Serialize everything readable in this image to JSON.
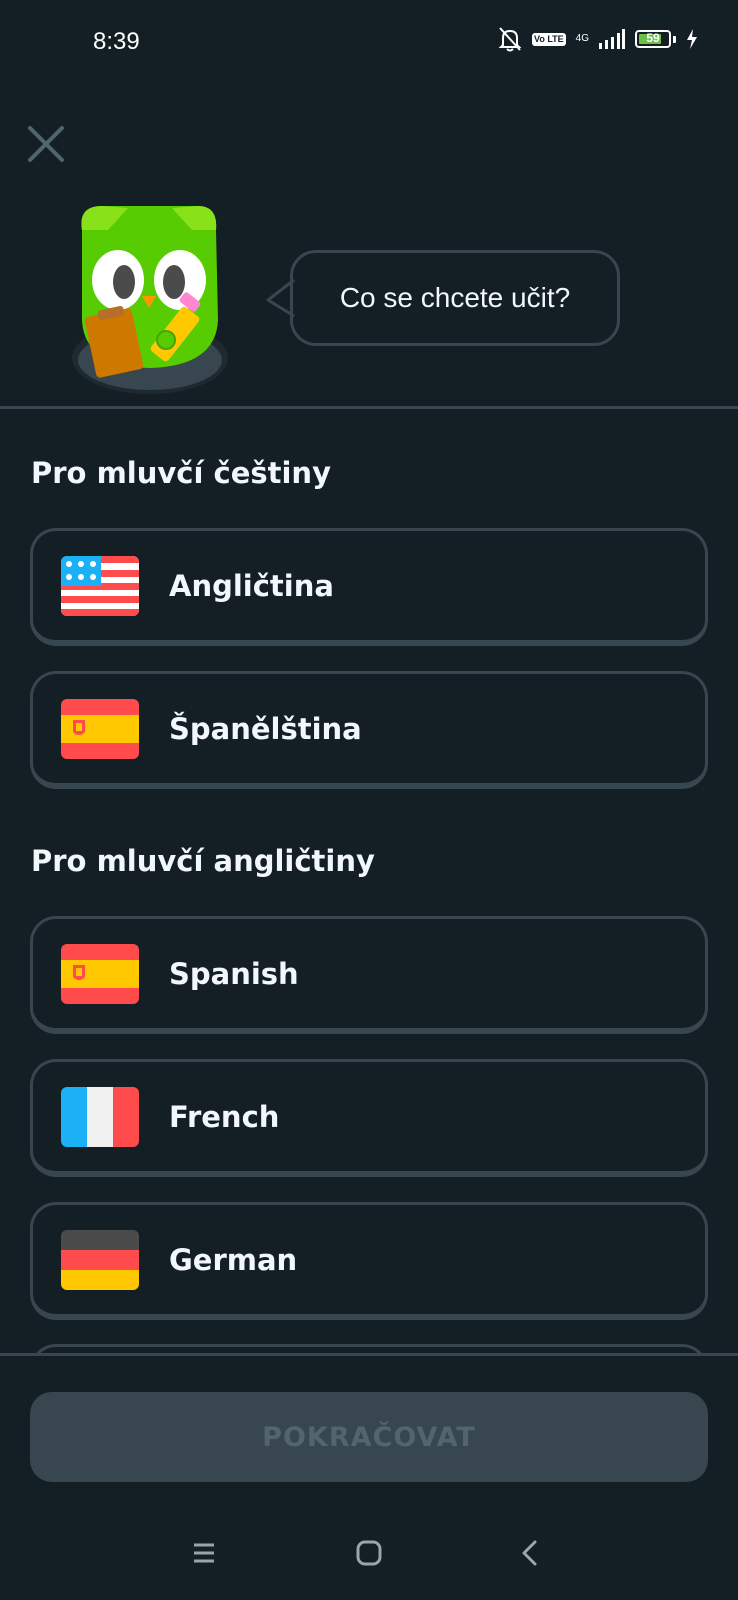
{
  "status_bar": {
    "time": "8:39",
    "volte_label": "Vo LTE",
    "network_label": "4G",
    "battery_percent": "59",
    "icons": [
      "bell-muted-icon",
      "volte-icon",
      "signal-icon",
      "battery-icon",
      "charging-icon"
    ]
  },
  "header": {
    "close_icon": "close-icon",
    "mascot": "owl-mascot-illustration",
    "speech_bubble": "Co se chcete učit?"
  },
  "sections": [
    {
      "title": "Pro mluvčí češtiny",
      "options": [
        {
          "label": "Angličtina",
          "flag": "us-flag-icon"
        },
        {
          "label": "Španělština",
          "flag": "spain-flag-icon"
        }
      ]
    },
    {
      "title": "Pro mluvčí angličtiny",
      "options": [
        {
          "label": "Spanish",
          "flag": "spain-flag-icon"
        },
        {
          "label": "French",
          "flag": "france-flag-icon"
        },
        {
          "label": "German",
          "flag": "germany-flag-icon"
        }
      ]
    }
  ],
  "footer": {
    "continue_label": "POKRAČOVAT",
    "continue_enabled": false
  },
  "navbar": {
    "icons": [
      "menu-nav-icon",
      "home-nav-icon",
      "back-nav-icon"
    ]
  },
  "colors": {
    "background": "#131f24",
    "card_border": "#37464f",
    "text": "#f1f7fb",
    "button_disabled_bg": "#37464f",
    "button_disabled_text": "#52656d",
    "owl_green": "#58cc02"
  }
}
